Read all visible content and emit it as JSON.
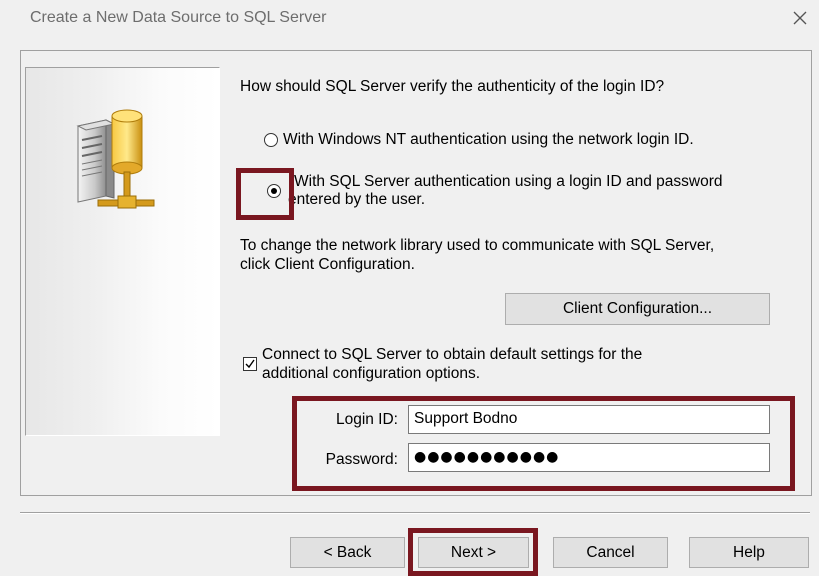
{
  "window": {
    "title": "Create a New Data Source to SQL Server",
    "close_icon": "close-icon"
  },
  "auth": {
    "question": "How should SQL Server verify the authenticity of the login ID?",
    "option_windows": "With Windows NT authentication using the network login ID.",
    "option_sql_line1": "With SQL Server authentication using a login ID and password",
    "option_sql_line2": "entered by the user.",
    "selected": "sql"
  },
  "network": {
    "text_line1": "To change the network library used to communicate with SQL Server,",
    "text_line2": "click Client Configuration.",
    "client_config_label": "Client Configuration..."
  },
  "connect": {
    "checkbox_line1": "Connect to SQL Server to obtain default settings for the",
    "checkbox_line2": "additional configuration options.",
    "checked": true
  },
  "credentials": {
    "login_label": "Login ID:",
    "login_value": "Support Bodno",
    "password_label": "Password:",
    "password_value": "●●●●●●●●●●●"
  },
  "buttons": {
    "back": "< Back",
    "next": "Next >",
    "cancel": "Cancel",
    "help": "Help"
  },
  "colors": {
    "highlight": "#7a1720",
    "dialog_bg": "#f0f0f0",
    "button_bg": "#e1e1e1"
  }
}
